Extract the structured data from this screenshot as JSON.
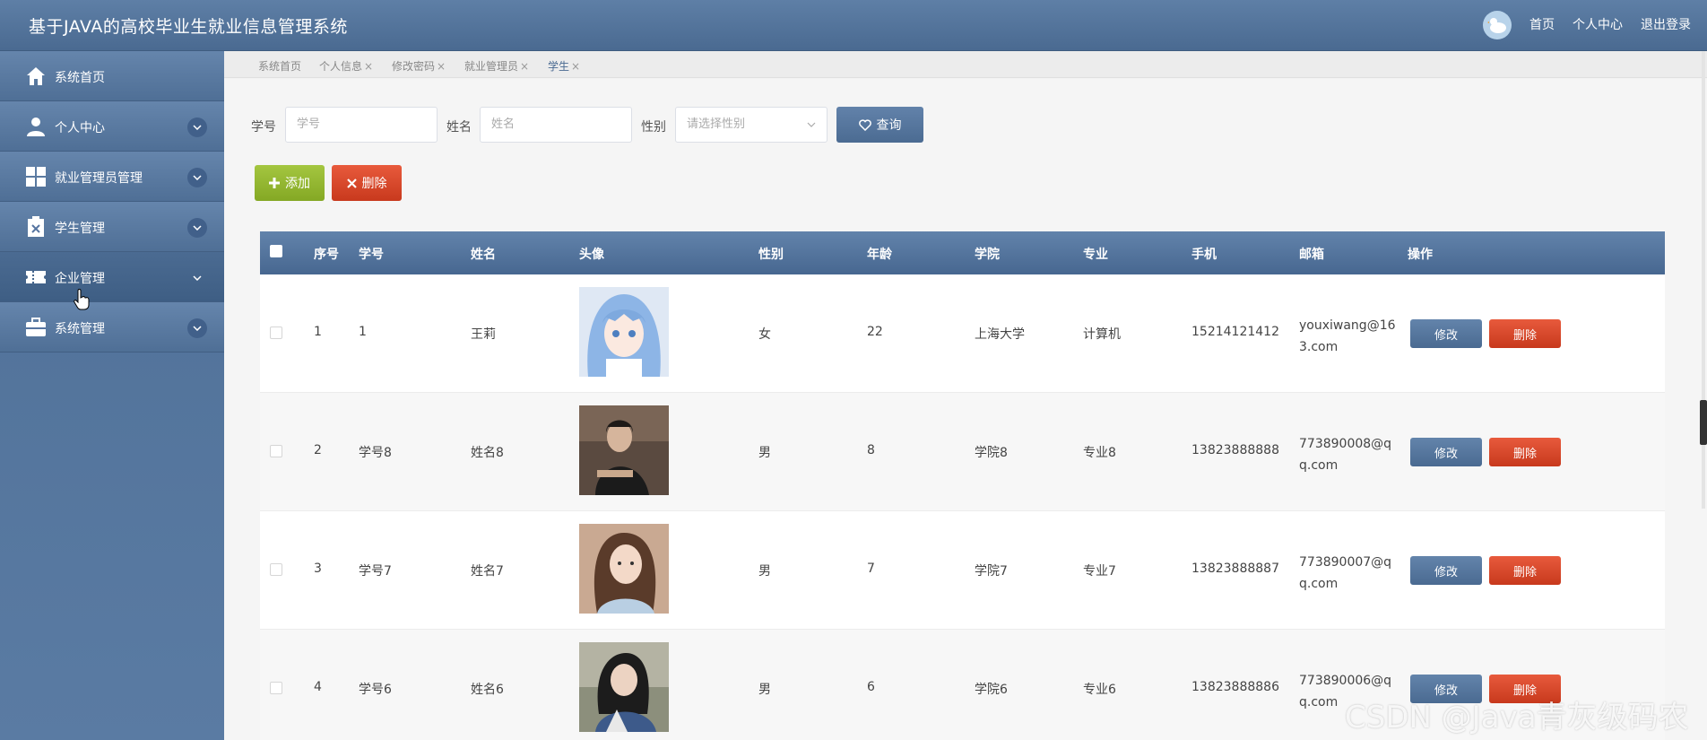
{
  "header": {
    "title": "基于JAVA的高校毕业生就业信息管理系统",
    "nav": [
      "首页",
      "个人中心",
      "退出登录"
    ]
  },
  "sidebar": {
    "items": [
      {
        "label": "系统首页",
        "icon": "home-icon",
        "expandable": false
      },
      {
        "label": "个人中心",
        "icon": "user-icon",
        "expandable": true
      },
      {
        "label": "就业管理员管理",
        "icon": "grid-icon",
        "expandable": true
      },
      {
        "label": "学生管理",
        "icon": "clipboard-icon",
        "expandable": true
      },
      {
        "label": "企业管理",
        "icon": "ticket-icon",
        "expandable": true
      },
      {
        "label": "系统管理",
        "icon": "briefcase-icon",
        "expandable": true
      }
    ]
  },
  "tabs": [
    {
      "label": "系统首页",
      "closable": false
    },
    {
      "label": "个人信息",
      "closable": true
    },
    {
      "label": "修改密码",
      "closable": true
    },
    {
      "label": "就业管理员",
      "closable": true
    },
    {
      "label": "学生",
      "closable": true,
      "active": true
    }
  ],
  "search": {
    "student_no_label": "学号",
    "student_no_placeholder": "学号",
    "name_label": "姓名",
    "name_placeholder": "姓名",
    "gender_label": "性别",
    "gender_placeholder": "请选择性别",
    "search_button": "查询"
  },
  "actions": {
    "add_button": "添加",
    "delete_button": "删除"
  },
  "table": {
    "columns": [
      "序号",
      "学号",
      "姓名",
      "头像",
      "性别",
      "年龄",
      "学院",
      "专业",
      "手机",
      "邮箱",
      "操作"
    ],
    "rows": [
      {
        "index": "1",
        "student_no": "1",
        "name": "王莉",
        "gender": "女",
        "age": "22",
        "college": "上海大学",
        "major": "计算机",
        "phone": "15214121412",
        "email": "youxiwang@163.com"
      },
      {
        "index": "2",
        "student_no": "学号8",
        "name": "姓名8",
        "gender": "男",
        "age": "8",
        "college": "学院8",
        "major": "专业8",
        "phone": "13823888888",
        "email": "773890008@qq.com"
      },
      {
        "index": "3",
        "student_no": "学号7",
        "name": "姓名7",
        "gender": "男",
        "age": "7",
        "college": "学院7",
        "major": "专业7",
        "phone": "13823888887",
        "email": "773890007@qq.com"
      },
      {
        "index": "4",
        "student_no": "学号6",
        "name": "姓名6",
        "gender": "男",
        "age": "6",
        "college": "学院6",
        "major": "专业6",
        "phone": "13823888886",
        "email": "773890006@qq.com"
      }
    ],
    "edit_label": "修改",
    "delete_label": "删除"
  },
  "watermark": "CSDN @Java青灰级码农",
  "colors": {
    "primary": "#4a6a91",
    "add": "#95b831",
    "danger": "#d9482a"
  }
}
